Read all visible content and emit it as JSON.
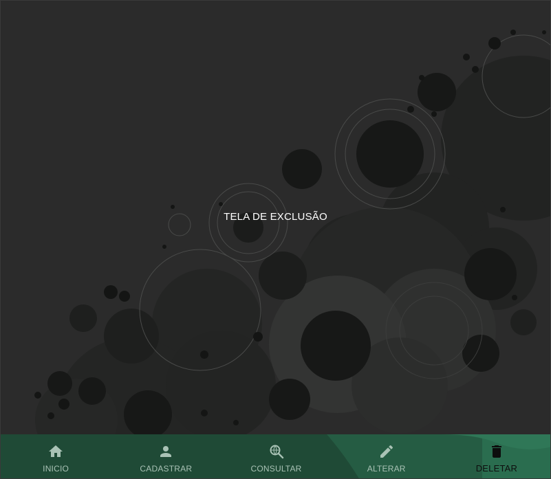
{
  "page": {
    "title": "TELA DE EXCLUSÃO"
  },
  "nav": {
    "items": [
      {
        "label": "INICIO",
        "icon": "home-icon",
        "active": false
      },
      {
        "label": "CADASTRAR",
        "icon": "person-icon",
        "active": false
      },
      {
        "label": "CONSULTAR",
        "icon": "search-web-icon",
        "active": false
      },
      {
        "label": "ALTERAR",
        "icon": "pencil-icon",
        "active": false
      },
      {
        "label": "DELETAR",
        "icon": "trash-icon",
        "active": true
      }
    ]
  },
  "colors": {
    "background": "#2b2b2b",
    "nav_background": "#1f4a36",
    "nav_active_wave": "#2a6d4f",
    "nav_inactive_text": "#a9c2b5",
    "nav_active_text": "#0d0d0d"
  }
}
